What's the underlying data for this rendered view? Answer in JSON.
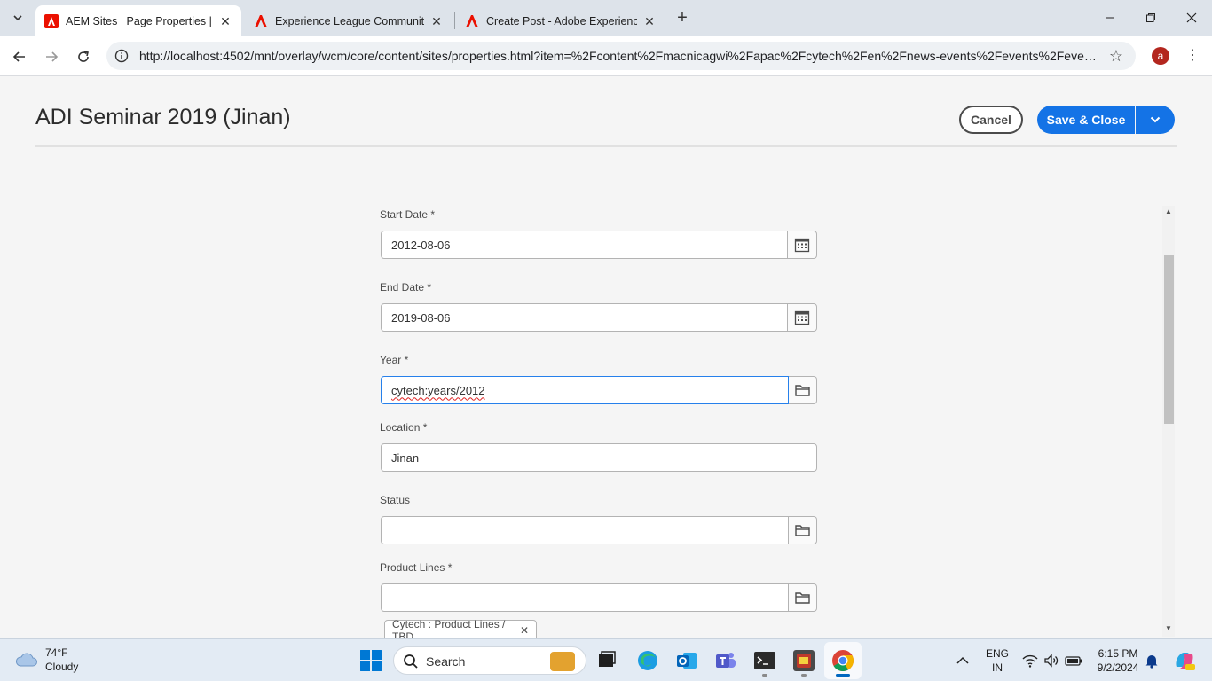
{
  "browser": {
    "tabs": [
      {
        "title": "AEM Sites | Page Properties | AEM",
        "active": true
      },
      {
        "title": "Experience League Community",
        "active": false
      },
      {
        "title": "Create Post - Adobe Experience",
        "active": false
      }
    ],
    "url": "http://localhost:4502/mnt/overlay/wcm/core/content/sites/properties.html?item=%2Fcontent%2Fmacnicagwi%2Fapac%2Fcytech%2Fen%2Fnews-events%2Fevents%2Fevent...",
    "profile_initial": "a"
  },
  "header": {
    "title": "ADI Seminar 2019 (Jinan)",
    "cancel_label": "Cancel",
    "save_label": "Save & Close"
  },
  "form": {
    "start_date": {
      "label": "Start Date *",
      "value": "2012-08-06"
    },
    "end_date": {
      "label": "End Date *",
      "value": "2019-08-06"
    },
    "year": {
      "label": "Year *",
      "value": "cytech:years/2012"
    },
    "location": {
      "label": "Location *",
      "value": "Jinan"
    },
    "status": {
      "label": "Status",
      "value": ""
    },
    "product_lines": {
      "label": "Product Lines *",
      "value": "",
      "tags": [
        "Cytech : Product Lines / TBD"
      ]
    }
  },
  "taskbar": {
    "weather_temp": "74°F",
    "weather_desc": "Cloudy",
    "search_label": "Search",
    "lang_top": "ENG",
    "lang_bottom": "IN",
    "time": "6:15 PM",
    "date": "9/2/2024"
  },
  "colors": {
    "accent": "#1473e6",
    "focus": "#2680eb",
    "adobe_red": "#eb1000"
  }
}
